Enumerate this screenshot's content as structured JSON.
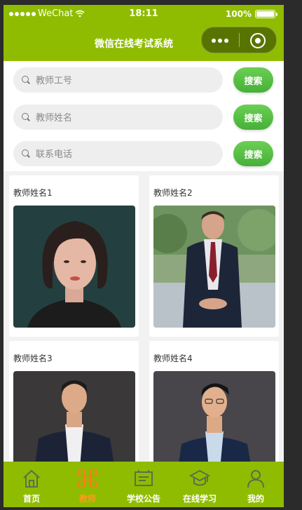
{
  "status_bar": {
    "carrier": "WeChat",
    "time": "18:11",
    "battery": "100%"
  },
  "nav": {
    "title": "微信在线考试系统"
  },
  "search": {
    "rows": [
      {
        "placeholder": "教师工号",
        "button": "搜索"
      },
      {
        "placeholder": "教师姓名",
        "button": "搜索"
      },
      {
        "placeholder": "联系电话",
        "button": "搜索"
      }
    ]
  },
  "teachers": [
    {
      "name": "教师姓名1"
    },
    {
      "name": "教师姓名2"
    },
    {
      "name": "教师姓名3"
    },
    {
      "name": "教师姓名4"
    }
  ],
  "tabbar": {
    "tabs": [
      {
        "label": "首页",
        "icon": "home-icon"
      },
      {
        "label": "教师",
        "icon": "command-icon",
        "active": true
      },
      {
        "label": "学校公告",
        "icon": "notice-board-icon"
      },
      {
        "label": "在线学习",
        "icon": "graduation-cap-icon"
      },
      {
        "label": "我的",
        "icon": "user-icon"
      }
    ]
  },
  "colors": {
    "theme": "#8fbc00",
    "button": "#4fb843",
    "active_tab": "#ff9a1a"
  }
}
